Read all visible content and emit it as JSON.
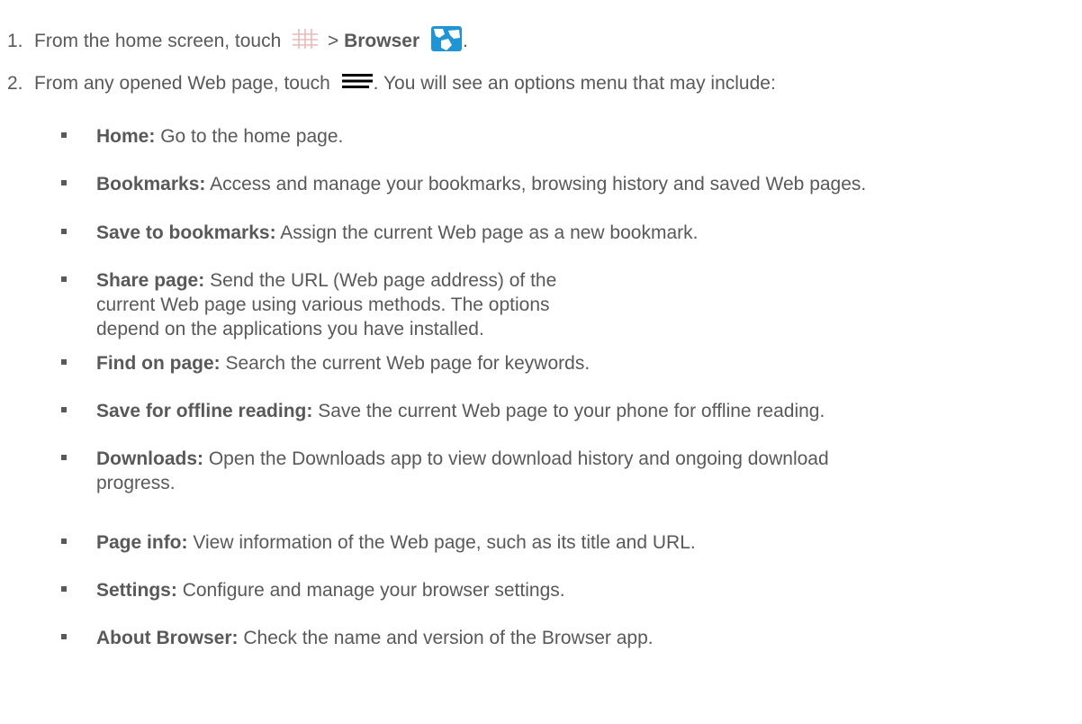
{
  "steps": [
    {
      "number": "1.",
      "text_before": "From the home screen, touch",
      "sep": ">",
      "app_name": "Browser",
      "text_after": ".",
      "icons": [
        "apps-grid-icon",
        "browser-globe-icon"
      ]
    },
    {
      "number": "2.",
      "text_before": "From any opened Web page, touch",
      "text_after": ". You will see an options menu that may include:",
      "icons": [
        "menu-icon"
      ]
    }
  ],
  "options": [
    {
      "term": "Home:",
      "desc": "Go to the home page."
    },
    {
      "term": "Bookmarks:",
      "desc": "Access and manage your bookmarks, browsing history and saved Web pages."
    },
    {
      "term": "Save to bookmarks:",
      "desc": "Assign the current Web page as a new bookmark."
    },
    {
      "term": "Share page:",
      "desc": "Send the URL (Web page address) of the current Web page using various methods. The options depend on the applications you have installed."
    },
    {
      "term": "Find on page:",
      "desc": "Search the current Web page for keywords."
    },
    {
      "term": "Save for offline reading:",
      "desc": "Save the current Web page to your phone for offline reading."
    },
    {
      "term": "Downloads:",
      "desc": "Open the Downloads app to view download history and ongoing download progress."
    },
    {
      "term": "Page info:",
      "desc": "View information of the Web page, such as its title and URL."
    },
    {
      "term": "Settings:",
      "desc": "Configure and manage your browser settings."
    },
    {
      "term": "About Browser:",
      "desc": "Check the name and version of the Browser app."
    }
  ]
}
